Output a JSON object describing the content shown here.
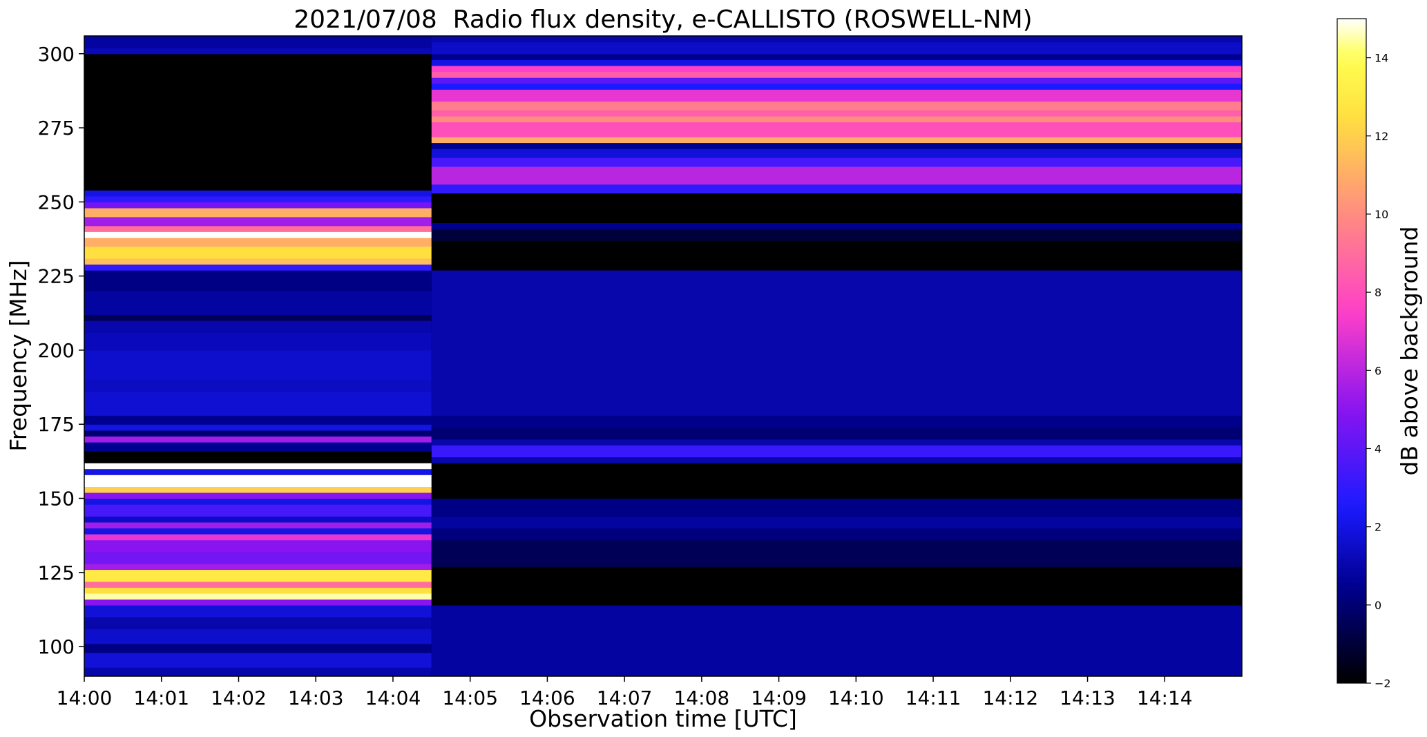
{
  "chart_data": {
    "type": "heatmap",
    "title": "2021/07/08  Radio flux density, e-CALLISTO (ROSWELL-NM)",
    "xlabel": "Observation time [UTC]",
    "ylabel": "Frequency [MHz]",
    "colorbar_label": "dB above background",
    "x_unit": "minutes after 14:00 UTC",
    "xlim": [
      0,
      15
    ],
    "ylim": [
      90,
      306
    ],
    "x_ticks": [
      0,
      1,
      2,
      3,
      4,
      5,
      6,
      7,
      8,
      9,
      10,
      11,
      12,
      13,
      14
    ],
    "x_tick_labels": [
      "14:00",
      "14:01",
      "14:02",
      "14:03",
      "14:04",
      "14:05",
      "14:06",
      "14:07",
      "14:08",
      "14:09",
      "14:10",
      "14:11",
      "14:12",
      "14:13",
      "14:14"
    ],
    "y_ticks": [
      100,
      125,
      150,
      175,
      200,
      225,
      250,
      275,
      300
    ],
    "y_tick_labels": [
      "100",
      "125",
      "150",
      "175",
      "200",
      "225",
      "250",
      "275",
      "300"
    ],
    "colorbar_range": [
      -2,
      15
    ],
    "colorbar_ticks": [
      -2,
      0,
      2,
      4,
      6,
      8,
      10,
      12,
      14
    ],
    "colorbar_tick_labels": [
      "−2",
      "0",
      "2",
      "4",
      "6",
      "8",
      "10",
      "12",
      "14"
    ],
    "colormap": "gnuplot2",
    "colormap_stops": [
      {
        "value": -2,
        "color": "#000000"
      },
      {
        "value": 0.5,
        "color": "#000090"
      },
      {
        "value": 2.5,
        "color": "#1a1aff"
      },
      {
        "value": 5,
        "color": "#8a14f0"
      },
      {
        "value": 7.5,
        "color": "#ff40c8"
      },
      {
        "value": 10,
        "color": "#ff8c80"
      },
      {
        "value": 12.5,
        "color": "#ffe040"
      },
      {
        "value": 14,
        "color": "#ffff50"
      },
      {
        "value": 15,
        "color": "#ffffff"
      }
    ],
    "segments": [
      {
        "time_range": [
          0,
          4.5
        ],
        "bands": [
          {
            "f": [
              90,
              93
            ],
            "db": 1.0
          },
          {
            "f": [
              93,
              98
            ],
            "db": 1.8
          },
          {
            "f": [
              98,
              101
            ],
            "db": 0.3
          },
          {
            "f": [
              101,
              106
            ],
            "db": 1.6
          },
          {
            "f": [
              106,
              110
            ],
            "db": 1.0
          },
          {
            "f": [
              110,
              114
            ],
            "db": 1.8
          },
          {
            "f": [
              114,
              116
            ],
            "db": 5.0
          },
          {
            "f": [
              116,
              118
            ],
            "db": 14.5
          },
          {
            "f": [
              118,
              120
            ],
            "db": 12.5
          },
          {
            "f": [
              120,
              122
            ],
            "db": 9.0
          },
          {
            "f": [
              122,
              126
            ],
            "db": 13.0
          },
          {
            "f": [
              126,
              128
            ],
            "db": 5.5
          },
          {
            "f": [
              128,
              132
            ],
            "db": 4.5
          },
          {
            "f": [
              132,
              136
            ],
            "db": 5.0
          },
          {
            "f": [
              136,
              138
            ],
            "db": 7.0
          },
          {
            "f": [
              138,
              140
            ],
            "db": 2.0
          },
          {
            "f": [
              140,
              142
            ],
            "db": 5.5
          },
          {
            "f": [
              142,
              144
            ],
            "db": 1.5
          },
          {
            "f": [
              144,
              148
            ],
            "db": 3.5
          },
          {
            "f": [
              148,
              150
            ],
            "db": 2.0
          },
          {
            "f": [
              150,
              152
            ],
            "db": 5.0
          },
          {
            "f": [
              152,
              154
            ],
            "db": 12.0
          },
          {
            "f": [
              154,
              158
            ],
            "db": 15.0
          },
          {
            "f": [
              158,
              160
            ],
            "db": 2.0
          },
          {
            "f": [
              160,
              162
            ],
            "db": 15.0
          },
          {
            "f": [
              162,
              166
            ],
            "db": -2.0
          },
          {
            "f": [
              166,
              169
            ],
            "db": 0.5
          },
          {
            "f": [
              169,
              171
            ],
            "db": 5.5
          },
          {
            "f": [
              171,
              173
            ],
            "db": 0.0
          },
          {
            "f": [
              173,
              175
            ],
            "db": 2.0
          },
          {
            "f": [
              175,
              178
            ],
            "db": 0.5
          },
          {
            "f": [
              178,
              186
            ],
            "db": 1.7
          },
          {
            "f": [
              186,
              190
            ],
            "db": 1.4
          },
          {
            "f": [
              190,
              200
            ],
            "db": 1.6
          },
          {
            "f": [
              200,
              206
            ],
            "db": 1.3
          },
          {
            "f": [
              206,
              210
            ],
            "db": 1.0
          },
          {
            "f": [
              210,
              212
            ],
            "db": -0.5
          },
          {
            "f": [
              212,
              220
            ],
            "db": 0.8
          },
          {
            "f": [
              220,
              227
            ],
            "db": 0.3
          },
          {
            "f": [
              227,
              229
            ],
            "db": 3.0
          },
          {
            "f": [
              229,
              231
            ],
            "db": 11.5
          },
          {
            "f": [
              231,
              235
            ],
            "db": 12.5
          },
          {
            "f": [
              235,
              238
            ],
            "db": 11.0
          },
          {
            "f": [
              238,
              240
            ],
            "db": 15.0
          },
          {
            "f": [
              240,
              242
            ],
            "db": 9.0
          },
          {
            "f": [
              242,
              245
            ],
            "db": 5.5
          },
          {
            "f": [
              245,
              248
            ],
            "db": 11.0
          },
          {
            "f": [
              248,
              250
            ],
            "db": 4.5
          },
          {
            "f": [
              250,
              252
            ],
            "db": 3.0
          },
          {
            "f": [
              252,
              254
            ],
            "db": 2.0
          },
          {
            "f": [
              254,
              300
            ],
            "db": -2.0
          },
          {
            "f": [
              300,
              302
            ],
            "db": 1.2
          },
          {
            "f": [
              302,
              306
            ],
            "db": 0.8
          }
        ]
      },
      {
        "time_range": [
          4.5,
          15
        ],
        "bands": [
          {
            "f": [
              90,
              114
            ],
            "db": 0.8
          },
          {
            "f": [
              114,
              127
            ],
            "db": -2.0
          },
          {
            "f": [
              127,
              136
            ],
            "db": -0.5
          },
          {
            "f": [
              136,
              140
            ],
            "db": 0.2
          },
          {
            "f": [
              140,
              144
            ],
            "db": 0.8
          },
          {
            "f": [
              144,
              150
            ],
            "db": 0.3
          },
          {
            "f": [
              150,
              162
            ],
            "db": -2.0
          },
          {
            "f": [
              162,
              164
            ],
            "db": 1.0
          },
          {
            "f": [
              164,
              168
            ],
            "db": 3.2
          },
          {
            "f": [
              168,
              170
            ],
            "db": 1.0
          },
          {
            "f": [
              170,
              174
            ],
            "db": 0.0
          },
          {
            "f": [
              174,
              178
            ],
            "db": 0.4
          },
          {
            "f": [
              178,
              227
            ],
            "db": 1.0
          },
          {
            "f": [
              227,
              237
            ],
            "db": -2.0
          },
          {
            "f": [
              237,
              241
            ],
            "db": -1.0
          },
          {
            "f": [
              241,
              243
            ],
            "db": 0.5
          },
          {
            "f": [
              243,
              253
            ],
            "db": -2.0
          },
          {
            "f": [
              253,
              256
            ],
            "db": 3.0
          },
          {
            "f": [
              256,
              262
            ],
            "db": 6.0
          },
          {
            "f": [
              262,
              265
            ],
            "db": 3.5
          },
          {
            "f": [
              265,
              268
            ],
            "db": 1.8
          },
          {
            "f": [
              268,
              270
            ],
            "db": 0.5
          },
          {
            "f": [
              270,
              272
            ],
            "db": 11.0
          },
          {
            "f": [
              272,
              277
            ],
            "db": 8.0
          },
          {
            "f": [
              277,
              279
            ],
            "db": 10.0
          },
          {
            "f": [
              279,
              281
            ],
            "db": 8.5
          },
          {
            "f": [
              281,
              284
            ],
            "db": 9.5
          },
          {
            "f": [
              284,
              288
            ],
            "db": 7.0
          },
          {
            "f": [
              288,
              290
            ],
            "db": 2.5
          },
          {
            "f": [
              290,
              292
            ],
            "db": 4.0
          },
          {
            "f": [
              292,
              294
            ],
            "db": 8.5
          },
          {
            "f": [
              294,
              296
            ],
            "db": 7.5
          },
          {
            "f": [
              296,
              298
            ],
            "db": 2.0
          },
          {
            "f": [
              298,
              300
            ],
            "db": 0.5
          },
          {
            "f": [
              300,
              304
            ],
            "db": 1.5
          },
          {
            "f": [
              304,
              306
            ],
            "db": 1.0
          }
        ]
      }
    ]
  }
}
